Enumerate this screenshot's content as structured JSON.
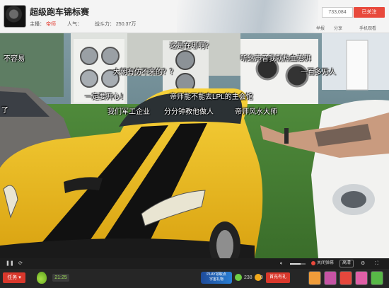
{
  "header": {
    "title": "超级跑车锦标赛",
    "host_label": "主播：",
    "host_name": "帝师",
    "popularity_label": "人气：",
    "popularity_value": "",
    "power_label": "战斗力：",
    "power_value": "250.37万",
    "counter": "733,084",
    "follow_label": "已关注",
    "actions": [
      "举报",
      "分享",
      "手机观看"
    ],
    "banner_color": "#b7c2cb"
  },
  "danmaku": [
    "这是在哪啊？",
    "不容易",
    "听这声音我就热血澎湃",
    "大朝有仿不来的？？",
    "一百多万人",
    "一定要开心！",
    "帝师能不能去LPL的主会馆",
    "了",
    "我们军工企业",
    "分分钟教他做人",
    "帝师风水大师"
  ],
  "photo": {
    "description_icon": "yellow-sports-car-photo",
    "car_color": "#f2c21b",
    "stripe_color": "#111111"
  },
  "controls": {
    "hd_label": "高清",
    "barrage_label": "关闭弹幕",
    "volume_level": 0.7
  },
  "bottom": {
    "task_label": "任务",
    "timer": "21:25",
    "promo_line1": "PLAY领取点",
    "promo_line2": "宇宙礼物",
    "coin_count": "238",
    "bean_count": "0",
    "first_charge_label": "首充有礼",
    "accent": "#d9382c"
  }
}
